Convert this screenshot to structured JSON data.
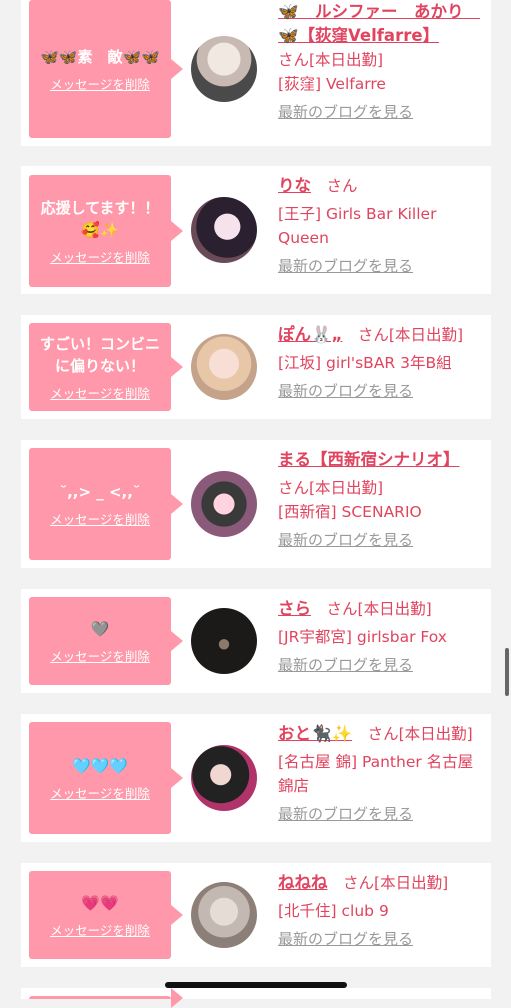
{
  "delete_label": "メッセージを削除",
  "blog_label": "最新のブログを見る",
  "san_label": "さん",
  "cards": [
    {
      "message": "🦋🦋素　敵🦋🦋",
      "name": "🦋　ルシファー　あかり　🦋【荻窪Velfarre】",
      "status": "さん[本日出勤]",
      "shop": "[荻窪] Velfarre"
    },
    {
      "message": "応援してます！！🥰✨",
      "name": "りな",
      "status": "さん",
      "shop": "[王子] Girls Bar Killer Queen"
    },
    {
      "message": "すごい！コンビニに偏りない！",
      "name": "ぽん🐰„",
      "status": "さん[本日出勤]",
      "shop": "[江坂] girl'sBAR 3年B組"
    },
    {
      "message": "˘,,> _ <,,˘",
      "name": "まる【西新宿シナリオ】",
      "status": "さん[本日出勤]",
      "shop": "[西新宿] SCENARIO"
    },
    {
      "message": "🩶",
      "name": "さら",
      "status": "さん[本日出勤]",
      "shop": "[JR宇都宮] girlsbar Fox"
    },
    {
      "message": "🩵🩵🩵",
      "name": "おと🐈‍⬛✨",
      "status": "さん[本日出勤]",
      "shop": "[名古屋 錦] Panther 名古屋錦店"
    },
    {
      "message": "💗💗",
      "name": "ねねね",
      "status": "さん[本日出勤]",
      "shop": "[北千住] club 9"
    }
  ],
  "colors": {
    "accent": "#e0445e",
    "bubble": "#ff98aa",
    "link_gray": "#999999",
    "background": "#f2f2f2"
  }
}
